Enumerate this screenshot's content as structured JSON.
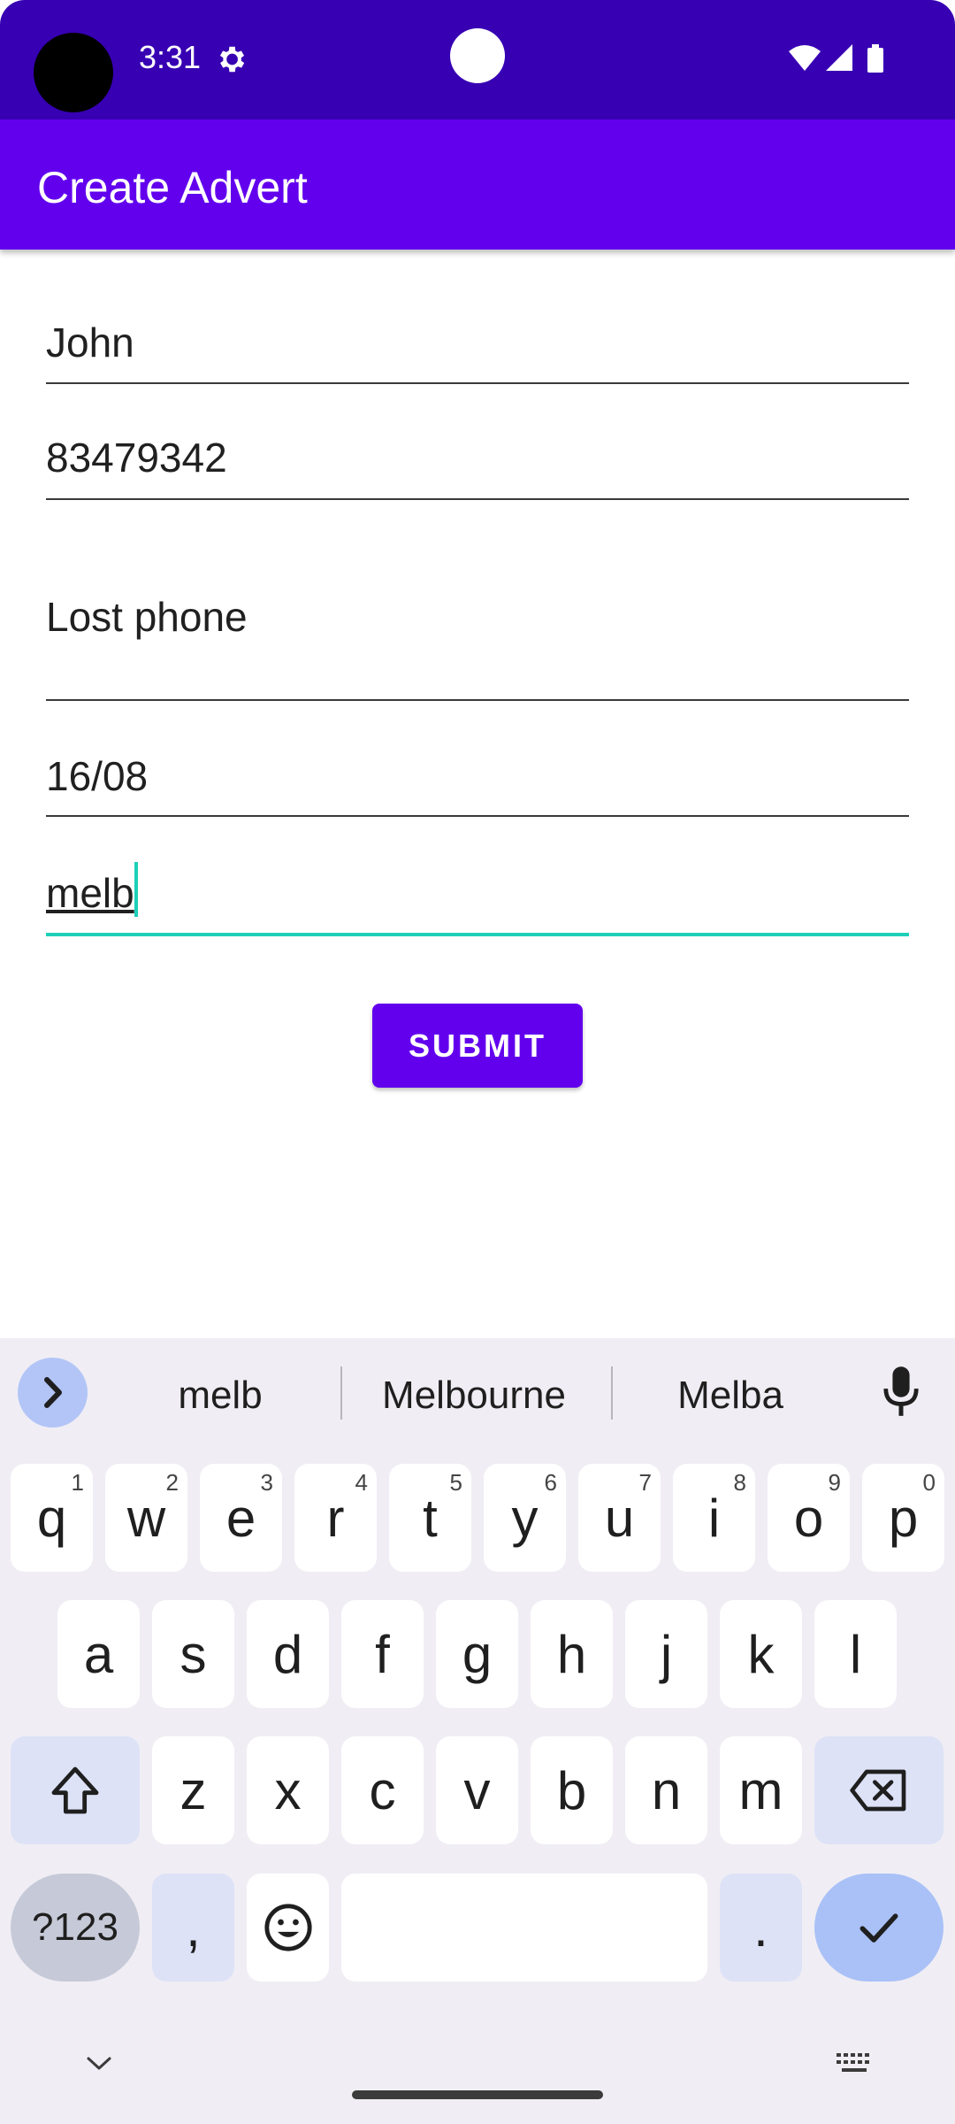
{
  "status_bar": {
    "time": "3:31"
  },
  "app_bar": {
    "title": "Create Advert"
  },
  "form": {
    "name_value": "John",
    "phone_value": "83479342",
    "description_value": "Lost phone",
    "date_value": "16/08",
    "location_value": "melb",
    "submit_label": "SUBMIT"
  },
  "keyboard": {
    "suggestions": [
      "melb",
      "Melbourne",
      "Melba"
    ],
    "row1": [
      {
        "key": "q",
        "hint": "1"
      },
      {
        "key": "w",
        "hint": "2"
      },
      {
        "key": "e",
        "hint": "3"
      },
      {
        "key": "r",
        "hint": "4"
      },
      {
        "key": "t",
        "hint": "5"
      },
      {
        "key": "y",
        "hint": "6"
      },
      {
        "key": "u",
        "hint": "7"
      },
      {
        "key": "i",
        "hint": "8"
      },
      {
        "key": "o",
        "hint": "9"
      },
      {
        "key": "p",
        "hint": "0"
      }
    ],
    "row2": [
      "a",
      "s",
      "d",
      "f",
      "g",
      "h",
      "j",
      "k",
      "l"
    ],
    "row3": [
      "z",
      "x",
      "c",
      "v",
      "b",
      "n",
      "m"
    ],
    "symbols_label": "?123",
    "comma_label": ",",
    "period_label": "."
  },
  "colors": {
    "status_bar": "#3700b3",
    "app_bar": "#6200ee",
    "accent": "#1dcfb9"
  }
}
